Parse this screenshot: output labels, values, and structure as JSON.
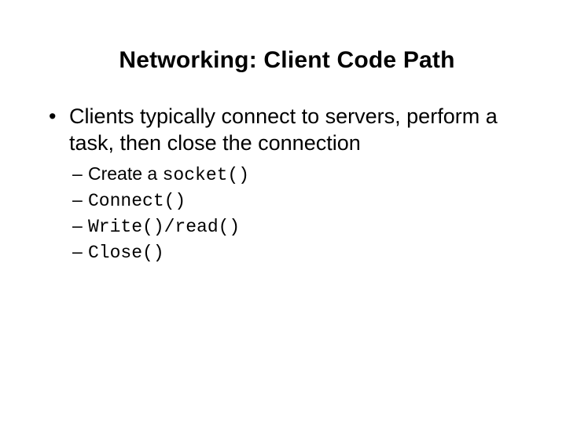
{
  "title": "Networking: Client Code Path",
  "bullet": {
    "text": "Clients typically connect to servers, perform a task, then close the connection",
    "sub": [
      {
        "prefix": "Create a ",
        "code": "socket()"
      },
      {
        "prefix": "",
        "code": "Connect()"
      },
      {
        "prefix": "",
        "code": "Write()/read()"
      },
      {
        "prefix": "",
        "code": "Close()"
      }
    ]
  }
}
